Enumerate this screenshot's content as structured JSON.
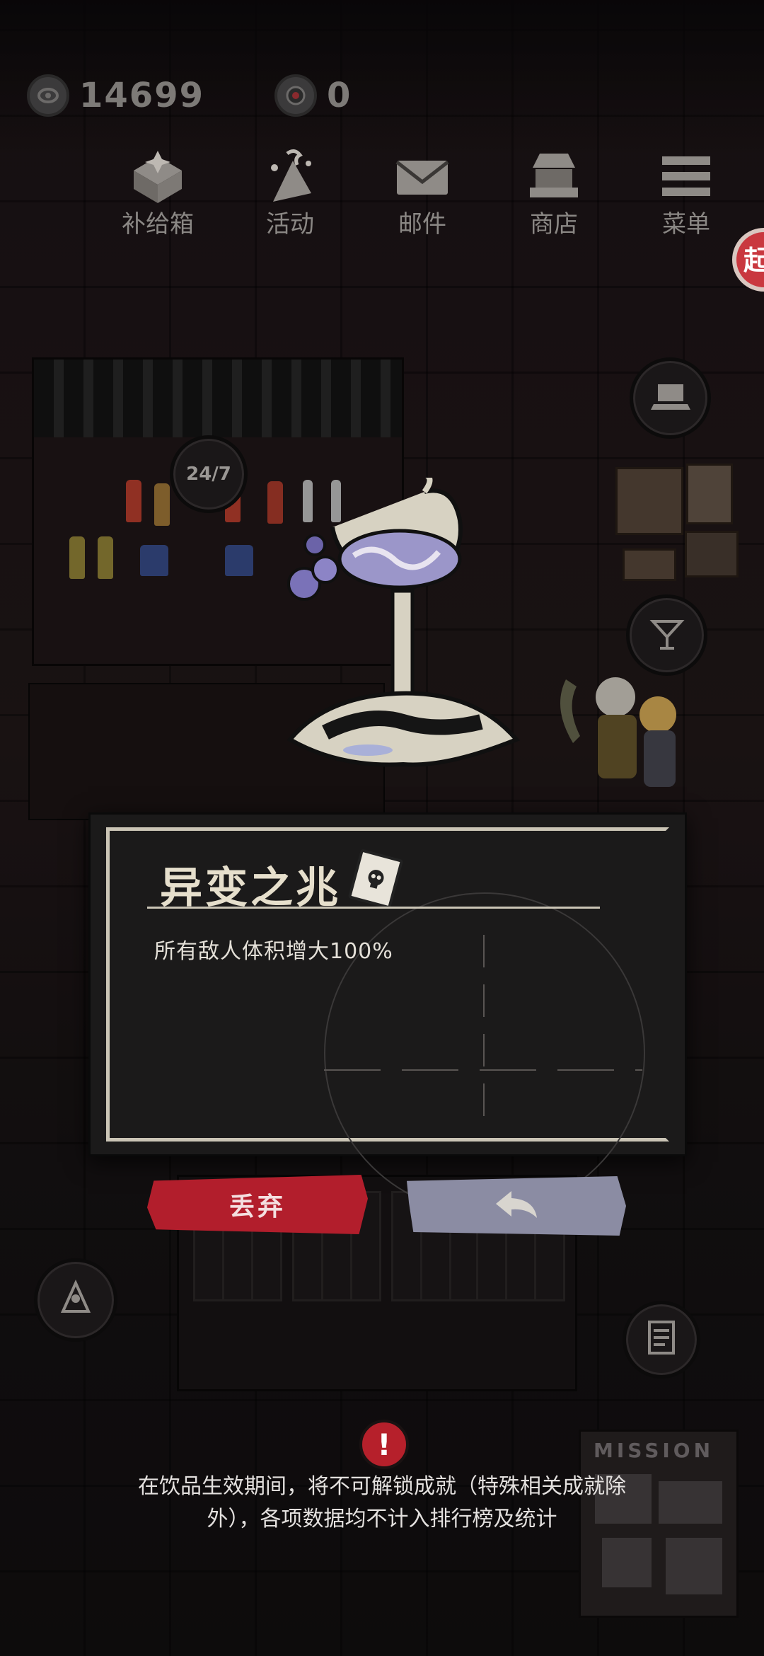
{
  "status": {
    "coins_value": "14699",
    "tokens_value": "0"
  },
  "menu": {
    "items": [
      {
        "label": "补给箱",
        "icon": "supply-box-icon"
      },
      {
        "label": "活动",
        "icon": "event-icon"
      },
      {
        "label": "邮件",
        "icon": "mail-icon"
      },
      {
        "label": "商店",
        "icon": "shop-icon"
      },
      {
        "label": "菜单",
        "icon": "menu-icon"
      }
    ]
  },
  "edge_badge": "起",
  "drink_card": {
    "title": "异变之兆",
    "description": "所有敌人体积增大100%"
  },
  "buttons": {
    "discard_label": "丢弃"
  },
  "notice": {
    "text": "在饮品生效期间，将不可解锁成就（特殊相关成就除外），各项数据均不计入排行榜及统计"
  },
  "mission_board": {
    "title": "MISSION"
  },
  "shelf_badge": "24/7",
  "colors": {
    "discard": "#b21e2c",
    "back": "#8b8ca3",
    "card_frame": "#cbc5b6",
    "warning": "#b6202b"
  }
}
